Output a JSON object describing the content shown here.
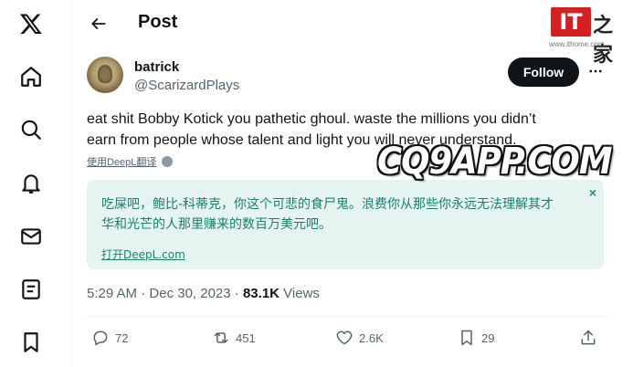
{
  "nav": {
    "items": [
      {
        "name": "x-logo-icon"
      },
      {
        "name": "home-icon"
      },
      {
        "name": "explore-icon"
      },
      {
        "name": "notifications-icon"
      },
      {
        "name": "messages-icon"
      },
      {
        "name": "lists-icon"
      },
      {
        "name": "bookmarks-icon"
      }
    ]
  },
  "header": {
    "title": "Post"
  },
  "watermark": {
    "logo_it": "IT",
    "logo_zh": "之家",
    "logo_url": "www.ithome.com",
    "overlay_text": "CQ9APP.COM"
  },
  "author": {
    "name": "batrick",
    "handle": "@ScarizardPlays",
    "follow_label": "Follow"
  },
  "tweet": {
    "line1": "eat shit Bobby Kotick you pathetic ghoul. waste the millions you didn’t",
    "line2": "earn from people whose talent and light you will never understand.",
    "translate_label": "使用DeepL翻译"
  },
  "translation": {
    "close": "×",
    "line1": "吃屎吧，鲍比-科蒂克，你这个可悲的食尸鬼。浪费你从那些你永远无法理解其才",
    "line2": "华和光芒的人那里赚来的数百万美元吧。",
    "open_label": "打开DeepL.com"
  },
  "meta": {
    "time": "5:29 AM",
    "sep1": " · ",
    "date": "Dec 30, 2023",
    "sep2": " · ",
    "views_count": "83.1K",
    "views_label": " Views"
  },
  "actions": {
    "replies": "72",
    "reposts": "451",
    "likes": "2.6K",
    "bookmarks": "29"
  },
  "colors": {
    "accent": "#0f1419",
    "secondary_text": "#536471",
    "translation_bg": "#e6f4f1",
    "translation_text": "#1b7f6e",
    "logo_red": "#d42020"
  }
}
